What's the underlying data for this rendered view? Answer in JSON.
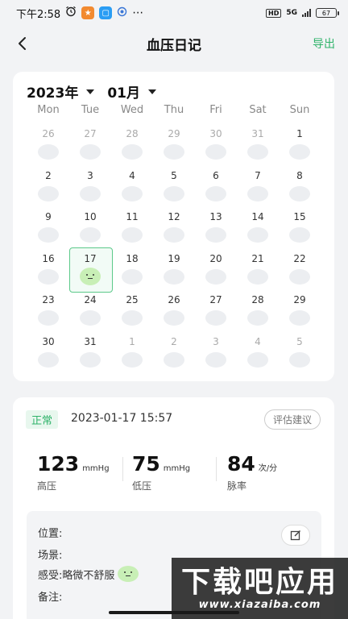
{
  "status_bar": {
    "time": "下午2:58",
    "network": "5G",
    "battery": "67"
  },
  "header": {
    "title": "血压日记",
    "export_label": "导出"
  },
  "calendar": {
    "year": "2023年",
    "month": "01月",
    "weekdays": [
      "Mon",
      "Tue",
      "Wed",
      "Thu",
      "Fri",
      "Sat",
      "Sun"
    ],
    "days": [
      {
        "n": "26",
        "other": true
      },
      {
        "n": "27",
        "other": true
      },
      {
        "n": "28",
        "other": true
      },
      {
        "n": "29",
        "other": true
      },
      {
        "n": "30",
        "other": true
      },
      {
        "n": "31",
        "other": true
      },
      {
        "n": "1"
      },
      {
        "n": "2"
      },
      {
        "n": "3"
      },
      {
        "n": "4"
      },
      {
        "n": "5"
      },
      {
        "n": "6"
      },
      {
        "n": "7"
      },
      {
        "n": "8"
      },
      {
        "n": "9"
      },
      {
        "n": "10"
      },
      {
        "n": "11"
      },
      {
        "n": "12"
      },
      {
        "n": "13"
      },
      {
        "n": "14"
      },
      {
        "n": "15"
      },
      {
        "n": "16"
      },
      {
        "n": "17",
        "selected": true,
        "mood": true
      },
      {
        "n": "18"
      },
      {
        "n": "19"
      },
      {
        "n": "20"
      },
      {
        "n": "21"
      },
      {
        "n": "22"
      },
      {
        "n": "23"
      },
      {
        "n": "24"
      },
      {
        "n": "25"
      },
      {
        "n": "26"
      },
      {
        "n": "27"
      },
      {
        "n": "28"
      },
      {
        "n": "29"
      },
      {
        "n": "30"
      },
      {
        "n": "31"
      },
      {
        "n": "1",
        "other": true
      },
      {
        "n": "2",
        "other": true
      },
      {
        "n": "3",
        "other": true
      },
      {
        "n": "4",
        "other": true
      },
      {
        "n": "5",
        "other": true
      }
    ]
  },
  "record": {
    "status": "正常",
    "time": "2023-01-17 15:57",
    "advice_label": "评估建议",
    "systolic": {
      "value": "123",
      "unit": "mmHg",
      "label": "高压"
    },
    "diastolic": {
      "value": "75",
      "unit": "mmHg",
      "label": "低压"
    },
    "pulse": {
      "value": "84",
      "unit": "次/分",
      "label": "脉率"
    },
    "details": {
      "location": "位置:",
      "scene": "场景:",
      "feeling": "感受:略微不舒服",
      "note": "备注:"
    }
  },
  "watermark": {
    "main": "下载吧应用",
    "sub": "www.xiazaiba.com"
  },
  "colors": {
    "accent": "#2fb36a",
    "selected_border": "#5cc98a",
    "mood_face": "#c8efb6"
  }
}
